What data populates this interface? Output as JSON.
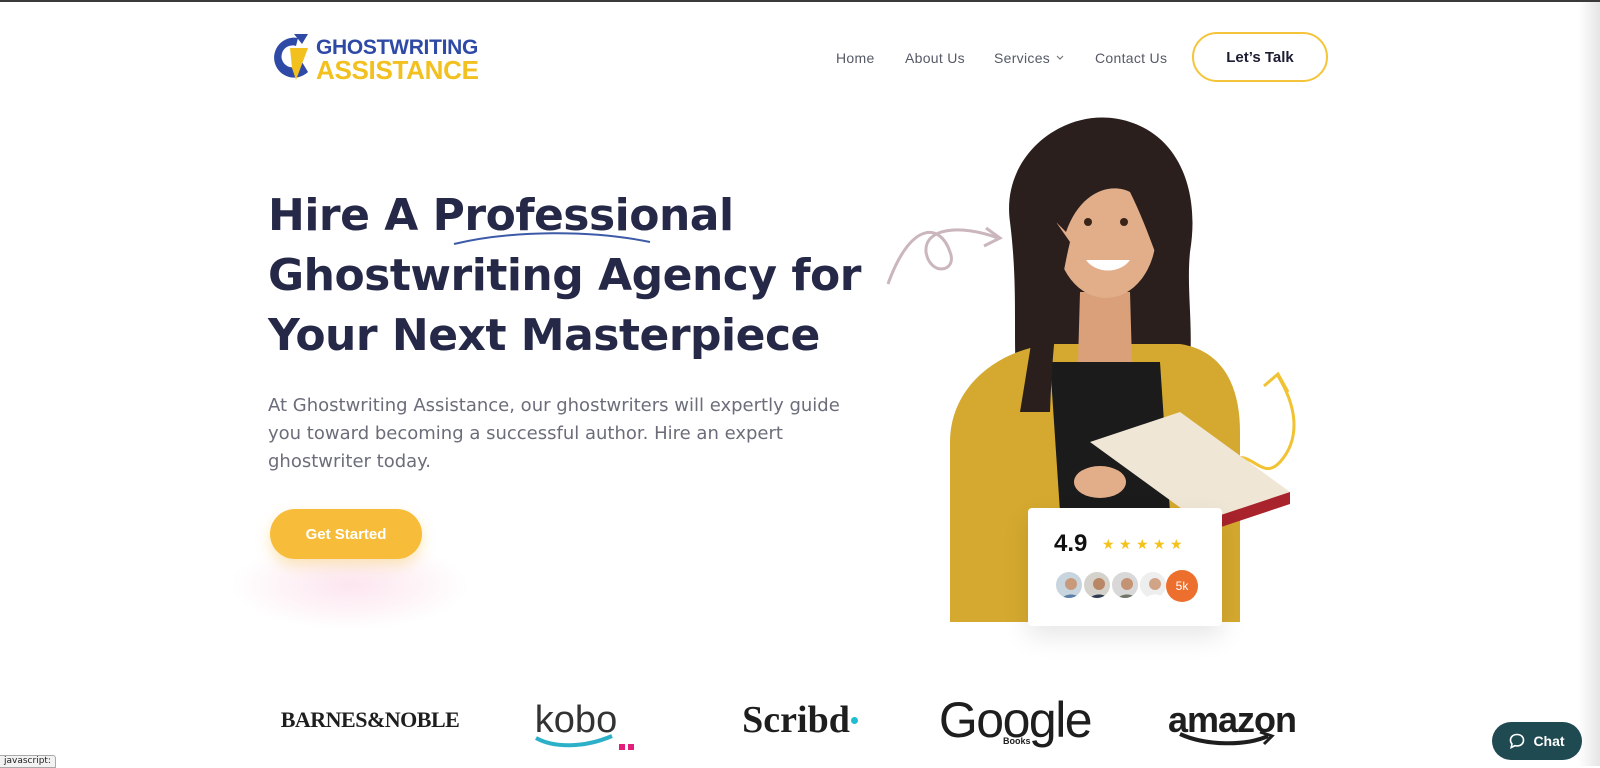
{
  "logo": {
    "line1": "GHOSTWRITING",
    "line2": "ASSISTANCE"
  },
  "nav": {
    "items": [
      {
        "label": "Home"
      },
      {
        "label": "About Us"
      },
      {
        "label": "Services"
      },
      {
        "label": "Contact Us"
      }
    ],
    "cta_label": "Let’s Talk"
  },
  "hero": {
    "title_lines": [
      "Hire A Professional",
      "Ghostwriting Agency for",
      "Your Next Masterpiece"
    ],
    "description": "At Ghostwriting Assistance, our ghostwriters will expertly guide you toward becoming a successful author. Hire an expert ghostwriter today.",
    "cta_label": "Get Started"
  },
  "rating": {
    "value": "4.9",
    "stars": 5,
    "reviews_badge": "5k"
  },
  "partners": [
    {
      "name": "BARNES&NOBLE"
    },
    {
      "name": "kobo"
    },
    {
      "name": "Scribd"
    },
    {
      "name": "Google",
      "sub": "Books"
    },
    {
      "name": "amazon"
    }
  ],
  "chat": {
    "label": "Chat"
  },
  "status_bar": {
    "text": "javascript:"
  },
  "colors": {
    "navy": "#262847",
    "yellow": "#f7bd3a",
    "logo_blue": "#2f4aa6",
    "logo_yellow": "#f2c01f",
    "chat_bg": "#1f4a52",
    "badge_orange": "#ec6f2e"
  }
}
